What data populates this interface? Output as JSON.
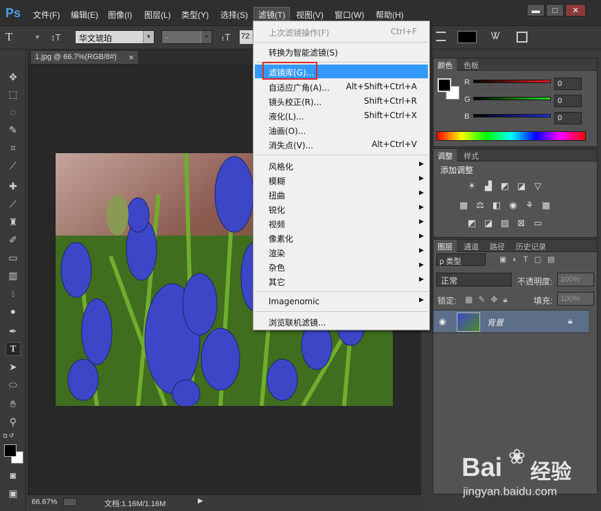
{
  "app": {
    "logo": "Ps"
  },
  "menubar": {
    "items": [
      "文件(F)",
      "编辑(E)",
      "图像(I)",
      "图层(L)",
      "类型(Y)",
      "选择(S)",
      "滤镜(T)",
      "视图(V)",
      "窗口(W)",
      "帮助(H)"
    ],
    "window_controls": {
      "minimize": "▬",
      "restore": "□",
      "close": "✕"
    }
  },
  "options": {
    "tool_glyph": "T",
    "orient_glyph": "↕T",
    "font_family": "华文琥珀",
    "font_style": "-",
    "size_glyph": "ₜT",
    "size_value": "72"
  },
  "document": {
    "tab_title": "1.jpg @ 66.7%(RGB/8#)",
    "tab_close": "×",
    "zoom": "66.67%",
    "doc_size": "文档:1.16M/1.16M"
  },
  "filter_menu": {
    "items": [
      {
        "label": "上次滤镜操作(F)",
        "shortcut": "Ctrl+F",
        "disabled": true
      },
      {
        "label": "转换为智能滤镜(S)",
        "shortcut": ""
      },
      {
        "label": "滤镜库(G)...",
        "shortcut": "",
        "highlight": true
      },
      {
        "label": "自适应广角(A)...",
        "shortcut": "Alt+Shift+Ctrl+A"
      },
      {
        "label": "镜头校正(R)...",
        "shortcut": "Shift+Ctrl+R"
      },
      {
        "label": "液化(L)...",
        "shortcut": "Shift+Ctrl+X"
      },
      {
        "label": "油画(O)...",
        "shortcut": ""
      },
      {
        "label": "消失点(V)...",
        "shortcut": "Alt+Ctrl+V"
      },
      {
        "label": "风格化",
        "submenu": true
      },
      {
        "label": "模糊",
        "submenu": true
      },
      {
        "label": "扭曲",
        "submenu": true
      },
      {
        "label": "锐化",
        "submenu": true
      },
      {
        "label": "视频",
        "submenu": true
      },
      {
        "label": "像素化",
        "submenu": true
      },
      {
        "label": "渲染",
        "submenu": true
      },
      {
        "label": "杂色",
        "submenu": true
      },
      {
        "label": "其它",
        "submenu": true
      },
      {
        "label": "Imagenomic",
        "submenu": true
      },
      {
        "label": "浏览联机滤镜..."
      }
    ]
  },
  "color_panel": {
    "tabs": [
      "颜色",
      "色板"
    ],
    "channels": [
      {
        "label": "R",
        "value": "0",
        "color": "#e03030"
      },
      {
        "label": "G",
        "value": "0",
        "color": "#30c030"
      },
      {
        "label": "B",
        "value": "0",
        "color": "#3040e0"
      }
    ]
  },
  "adjust_panel": {
    "tabs": [
      "调整",
      "样式"
    ],
    "title": "添加调整"
  },
  "layers_panel": {
    "tabs": [
      "图层",
      "通道",
      "路径",
      "历史记录"
    ],
    "filter_kind": "ρ 类型",
    "blend_mode": "正常",
    "opacity_label": "不透明度:",
    "opacity_value": "100%",
    "lock_label": "锁定:",
    "fill_label": "填充:",
    "fill_value": "100%",
    "layer_name": "背景"
  },
  "watermark": {
    "brand_left": "Bai",
    "brand_right": "经验",
    "url": "jingyan.baidu.com"
  }
}
